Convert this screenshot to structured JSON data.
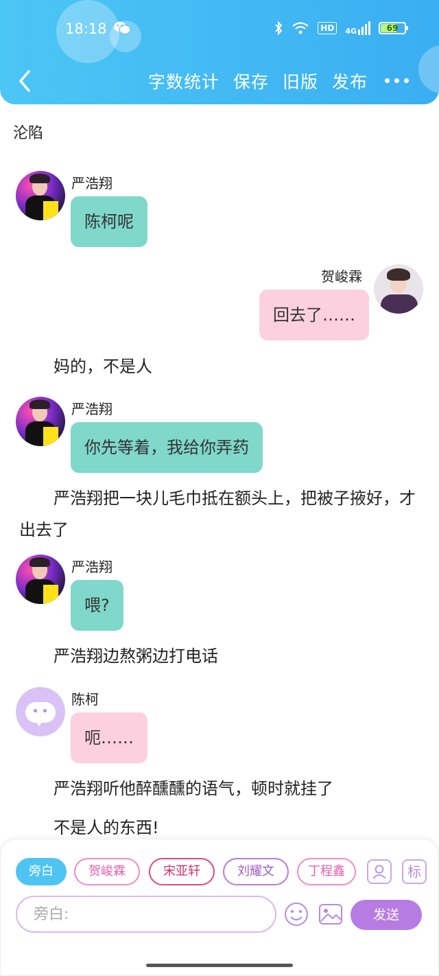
{
  "status_bar": {
    "time": "18:18",
    "hd": "HD",
    "network": "4G",
    "battery": "69"
  },
  "header": {
    "actions": [
      "字数统计",
      "保存",
      "旧版",
      "发布"
    ],
    "more": "more-icon",
    "colors": {
      "header_start": "#4cc6f5",
      "header_end": "#3aaef2"
    }
  },
  "doc": {
    "title": "沦陷"
  },
  "messages": [
    {
      "speaker": "严浩翔",
      "text": "陈柯呢",
      "side": "left",
      "color": "#7fd8ca"
    },
    {
      "speaker": "贺峻霖",
      "text": "回去了……",
      "side": "right",
      "color": "#fdd0df"
    },
    {
      "narration": "妈的，不是人"
    },
    {
      "speaker": "严浩翔",
      "text": "你先等着，我给你弄药",
      "side": "left",
      "color": "#7fd8ca"
    },
    {
      "narration": "严浩翔把一块儿毛巾抵在额头上，把被子掖好，才出去了"
    },
    {
      "speaker": "严浩翔",
      "text": "喂?",
      "side": "left",
      "color": "#7fd8ca"
    },
    {
      "narration": "严浩翔边熬粥边打电话"
    },
    {
      "speaker": "陈柯",
      "text": "呃……",
      "side": "left",
      "color": "#fdd0df"
    },
    {
      "narration": "严浩翔听他醉醺醺的语气，顿时就挂了"
    },
    {
      "narration": "不是人的东西!"
    }
  ],
  "composer": {
    "roles": [
      "旁白",
      "贺峻霖",
      "宋亚轩",
      "刘耀文",
      "丁程鑫"
    ],
    "active_role": "旁白",
    "mark_label": "标",
    "input_placeholder": "旁白:",
    "send_label": "发送",
    "send_color": "#b77ce2"
  }
}
